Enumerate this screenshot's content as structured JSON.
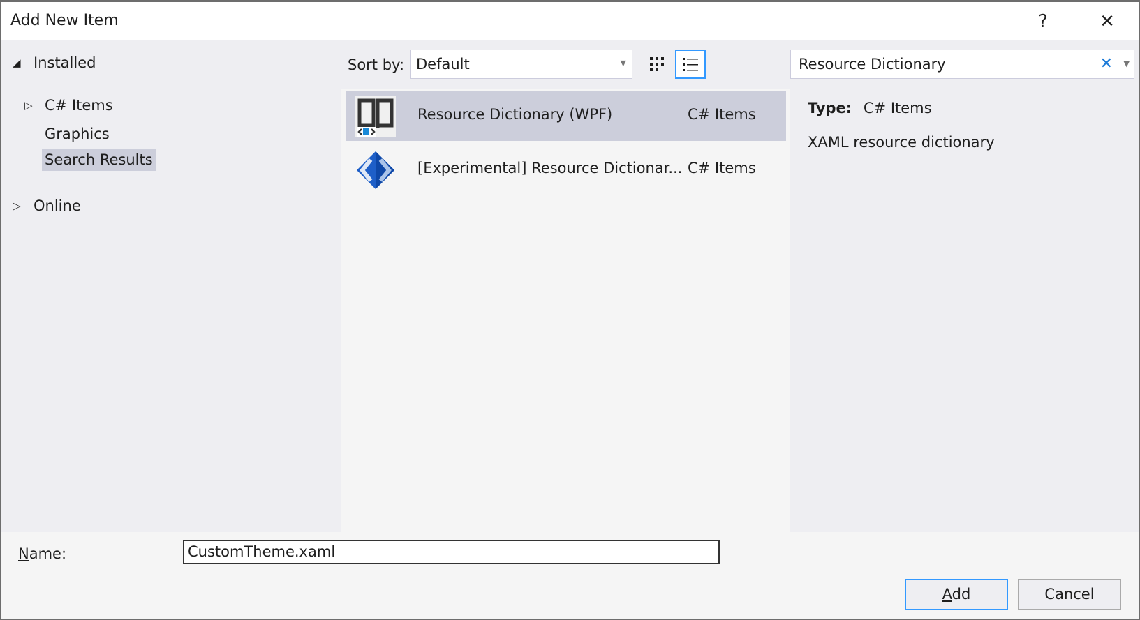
{
  "dialog": {
    "title": "Add New Item",
    "help_label": "?",
    "close_label": "✕"
  },
  "tree": {
    "installed": "Installed",
    "csharp_items": "C# Items",
    "graphics": "Graphics",
    "search_results": "Search Results",
    "online": "Online"
  },
  "toolbar": {
    "sort_label": "Sort by:",
    "sort_value": "Default",
    "view_modes": [
      "medium-icons",
      "list"
    ],
    "selected_view": "list"
  },
  "search": {
    "value": "Resource Dictionary",
    "clear_label": "✕"
  },
  "items": [
    {
      "name": "Resource Dictionary (WPF)",
      "category": "C# Items",
      "icon": "book-xaml-icon",
      "selected": true
    },
    {
      "name": "[Experimental] Resource Dictionar...",
      "category": "C# Items",
      "icon": "xaml-cube-icon",
      "selected": false
    }
  ],
  "details": {
    "type_label": "Type:",
    "type_value": "C# Items",
    "description": "XAML resource dictionary"
  },
  "footer": {
    "name_label_accel": "N",
    "name_label_rest": "ame:",
    "name_value": "CustomTheme.xaml",
    "add_accel": "A",
    "add_rest": "dd",
    "cancel_label": "Cancel"
  },
  "colors": {
    "accent": "#3399ff",
    "selection": "#cccedb",
    "background": "#eeeef2"
  }
}
